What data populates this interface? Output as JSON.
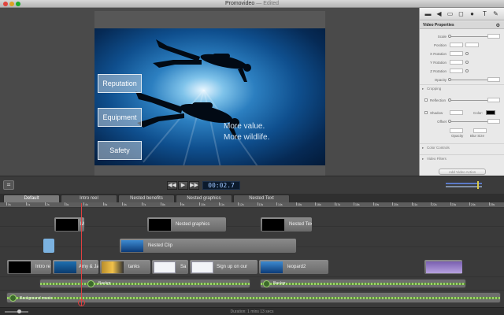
{
  "window": {
    "title": "Promovideo",
    "edited": "— Edited"
  },
  "slide": {
    "buttons": [
      "Reputation",
      "Equipment",
      "Safety"
    ],
    "caption_line1": "More value.",
    "caption_line2": "More wildlife."
  },
  "transport": {
    "rewind": "◀◀",
    "play": "▶",
    "forward": "▶▶",
    "timecode": "00:02.7"
  },
  "tabs": [
    "Default",
    "Intro reel",
    "Nested benefits",
    "Nested graphics",
    "Nested Text"
  ],
  "ruler": {
    "labels": [
      "0s",
      "1s",
      "2s",
      "3s",
      "4s",
      "5s",
      "6s",
      "7s",
      "8s",
      "9s",
      "10s",
      "11s",
      "12s",
      "13s",
      "14s",
      "15s",
      "16s",
      "17s",
      "18s",
      "19s",
      "20s",
      "21s",
      "22s",
      "23s",
      "24s",
      "25s"
    ]
  },
  "timeline": {
    "clips": {
      "m": "M",
      "nested_graphics": "Nested graphics",
      "nested_text": "Nested Tex",
      "nested_clip": "Nested Clip",
      "intro": "Intro re",
      "amy": "Amy & Ja",
      "tanks": "tanks",
      "sa": "Sa",
      "signup": "Sign up on our",
      "leopard": "leopard2"
    },
    "audio_clips": {
      "backgr": "Backgr",
      "backgr2": "Backgr"
    },
    "background": "Background music"
  },
  "status": "Duration: 1 mins 13 secs",
  "inspector": {
    "title": "Video Properties",
    "rows": [
      "Scale",
      "Position",
      "X Rotation",
      "Y Rotation",
      "Z Rotation",
      "Opacity"
    ],
    "cropping": "Cropping",
    "reflection": "Reflection",
    "shadow": "Shadow",
    "color_label": "Color:",
    "offset": "Offset",
    "opacity_label": "Opacity",
    "blur_label": "Blur Size",
    "color_controls": "Color Controls",
    "video_filters": "Video Filters",
    "add_action": "Add Video Action"
  },
  "colors": {
    "playhead": "#e04040",
    "timecode_text": "#9fc6ff"
  }
}
